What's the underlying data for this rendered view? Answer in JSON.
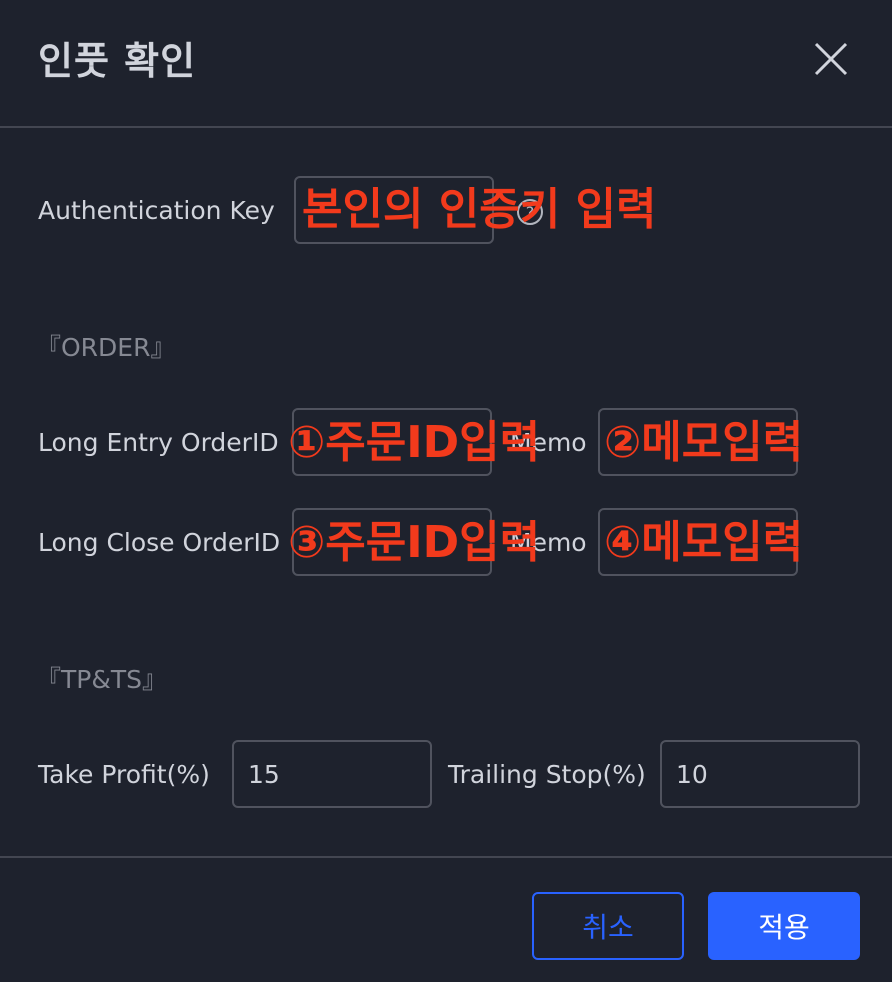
{
  "dialog": {
    "title": "인풋 확인",
    "close_icon": "close-icon"
  },
  "auth": {
    "label": "Authentication Key",
    "value": "",
    "annotation": "본인의 인증키 입력",
    "info_icon": "info-icon"
  },
  "order": {
    "section_title": "『ORDER』",
    "long_entry_label": "Long Entry OrderID",
    "long_entry_value": "",
    "long_entry_annotation": "①주문ID입력",
    "long_entry_memo_label": "Memo",
    "long_entry_memo_value": "",
    "long_entry_memo_annotation": "②메모입력",
    "long_close_label": "Long Close OrderID",
    "long_close_value": "",
    "long_close_annotation": "③주문ID입력",
    "long_close_memo_label": "Memo",
    "long_close_memo_value": "",
    "long_close_memo_annotation": "④메모입력"
  },
  "tpts": {
    "section_title": "『TP&TS』",
    "take_profit_label": "Take Profit(%)",
    "take_profit_value": "15",
    "trailing_stop_label": "Trailing Stop(%)",
    "trailing_stop_value": "10"
  },
  "footer": {
    "cancel_label": "취소",
    "apply_label": "적용"
  },
  "colors": {
    "background": "#1e222d",
    "accent": "#2962ff",
    "annotation_red": "#f23a1c",
    "border": "#50535e"
  }
}
